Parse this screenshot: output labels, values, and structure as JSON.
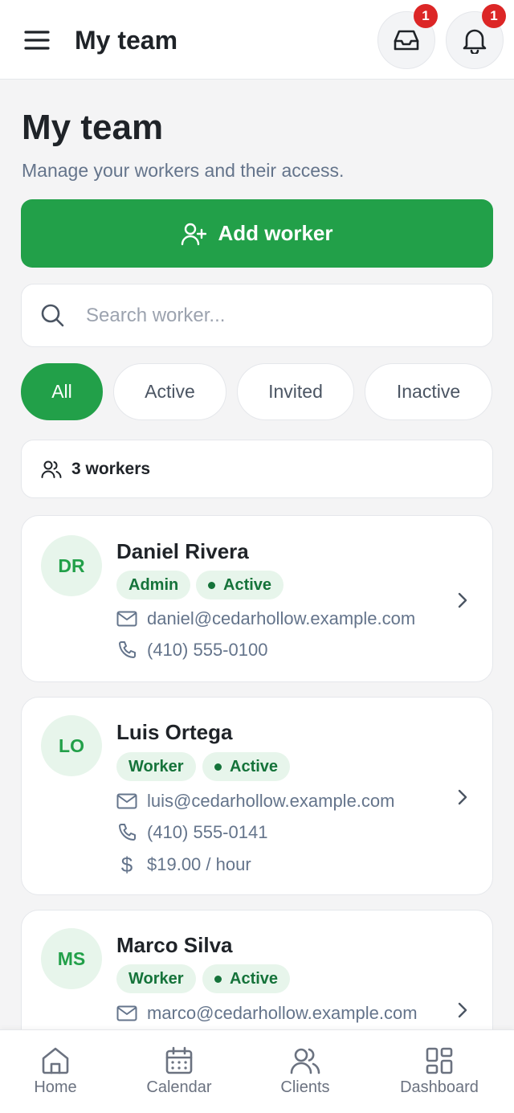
{
  "header": {
    "title": "My team",
    "inbox_badge": "1",
    "notifications_badge": "1"
  },
  "page": {
    "title": "My team",
    "subtitle": "Manage your workers and their access."
  },
  "add_button": {
    "label": "Add worker"
  },
  "search": {
    "placeholder": "Search worker...",
    "value": ""
  },
  "filters": [
    {
      "label": "All",
      "selected": true
    },
    {
      "label": "Active",
      "selected": false
    },
    {
      "label": "Invited",
      "selected": false
    },
    {
      "label": "Inactive",
      "selected": false
    }
  ],
  "count_label": "3 workers",
  "workers": [
    {
      "initials": "DR",
      "name": "Daniel Rivera",
      "role": "Admin",
      "status": "Active",
      "email": "daniel@cedarhollow.example.com",
      "phone": "(410) 555-0100"
    },
    {
      "initials": "LO",
      "name": "Luis Ortega",
      "role": "Worker",
      "status": "Active",
      "email": "luis@cedarhollow.example.com",
      "phone": "(410) 555-0141",
      "rate": "$19.00 / hour"
    },
    {
      "initials": "MS",
      "name": "Marco Silva",
      "role": "Worker",
      "status": "Active",
      "email": "marco@cedarhollow.example.com"
    }
  ],
  "bottom_nav": [
    {
      "label": "Home",
      "icon": "home-icon"
    },
    {
      "label": "Calendar",
      "icon": "calendar-icon"
    },
    {
      "label": "Clients",
      "icon": "users-icon"
    },
    {
      "label": "Dashboard",
      "icon": "dashboard-icon"
    }
  ],
  "colors": {
    "primary": "#22a049",
    "badge": "#dc2626",
    "tag_bg": "#e7f5eb",
    "tag_text": "#15733a"
  }
}
